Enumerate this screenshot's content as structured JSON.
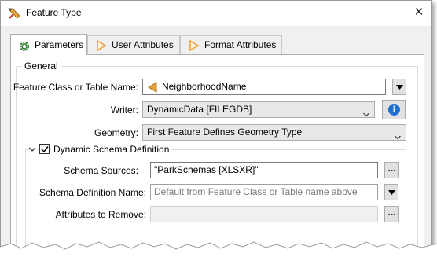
{
  "window": {
    "title": "Feature Type",
    "title_icon": "transformer-icon",
    "close_glyph": "✕"
  },
  "tabs": [
    {
      "label": "Parameters",
      "icon": "gear-icon",
      "active": true
    },
    {
      "label": "User Attributes",
      "icon": "attribute-arrow-icon",
      "active": false
    },
    {
      "label": "Format Attributes",
      "icon": "attribute-arrow-icon",
      "active": false
    }
  ],
  "general": {
    "title": "General",
    "feature_class_label": "Feature Class or Table Name:",
    "feature_class_value": "NeighborhoodName",
    "writer_label": "Writer:",
    "writer_value": "DynamicData [FILEGDB]",
    "geometry_label": "Geometry:",
    "geometry_value": "First Feature Defines Geometry Type"
  },
  "dynamic_schema": {
    "title": "Dynamic Schema Definition",
    "checked": true,
    "schema_sources_label": "Schema Sources:",
    "schema_sources_value": "\"ParkSchemas [XLSXR]\"",
    "schema_name_label": "Schema Definition Name:",
    "schema_name_placeholder": "Default from Feature Class or Table name above",
    "attributes_remove_label": "Attributes to Remove:",
    "attributes_remove_value": ""
  },
  "buttons": {
    "ellipsis": "..."
  },
  "colors": {
    "info_blue": "#1e6fd0",
    "attribute_orange": "#e8a23a",
    "panel_bg": "#f0f0f0"
  }
}
